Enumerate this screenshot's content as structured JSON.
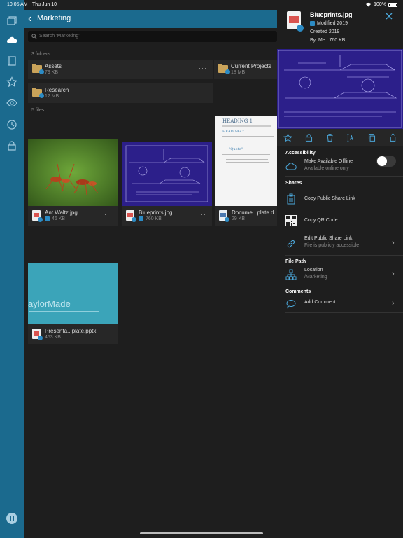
{
  "status": {
    "time": "10:05 AM",
    "date": "Thu Jun 10",
    "battery": "100%"
  },
  "header": {
    "title": "Marketing"
  },
  "search": {
    "placeholder": "Search 'Marketing'"
  },
  "folders": {
    "label": "3 folders",
    "items": [
      {
        "name": "Assets",
        "size": "79 KB"
      },
      {
        "name": "Current Projects",
        "size": "18 MB"
      },
      {
        "name": "Research",
        "size": "12 MB"
      }
    ]
  },
  "files": {
    "label": "5 files",
    "items": [
      {
        "name": "Ant Waltz.jpg",
        "size": "46 KB"
      },
      {
        "name": "Blueprints.jpg",
        "size": "760 KB"
      },
      {
        "name": "Docume...plate.d",
        "size": "29 KB"
      },
      {
        "name": "Presenta...plate.pptx",
        "size": "453 KB"
      }
    ]
  },
  "thumbs": {
    "doc_heading": "HEADING 1",
    "doc_subheading": "HEADING 2",
    "doc_quote": "\"Quote\"",
    "presentation_text": "aylorMade"
  },
  "panel": {
    "title": "Blueprints.jpg",
    "modified": "Modified 2019",
    "created": "Created 2019",
    "by": "By: Me | 760 KB",
    "accessibility_label": "Accessibility",
    "offline_title": "Make Available Offline",
    "offline_sub": "Available online only",
    "shares_label": "Shares",
    "copy_link": "Copy Public Share Link",
    "copy_qr": "Copy QR Code",
    "edit_link_title": "Edit Public Share Link",
    "edit_link_sub": "File is publicly accessible",
    "filepath_label": "File Path",
    "location_title": "Location",
    "location_sub": "/Marketing",
    "comments_label": "Comments",
    "add_comment": "Add Comment"
  },
  "colors": {
    "rail": "#1b6a8e",
    "accent": "#4ba6d8",
    "blueprint": "#2c1f8a"
  }
}
